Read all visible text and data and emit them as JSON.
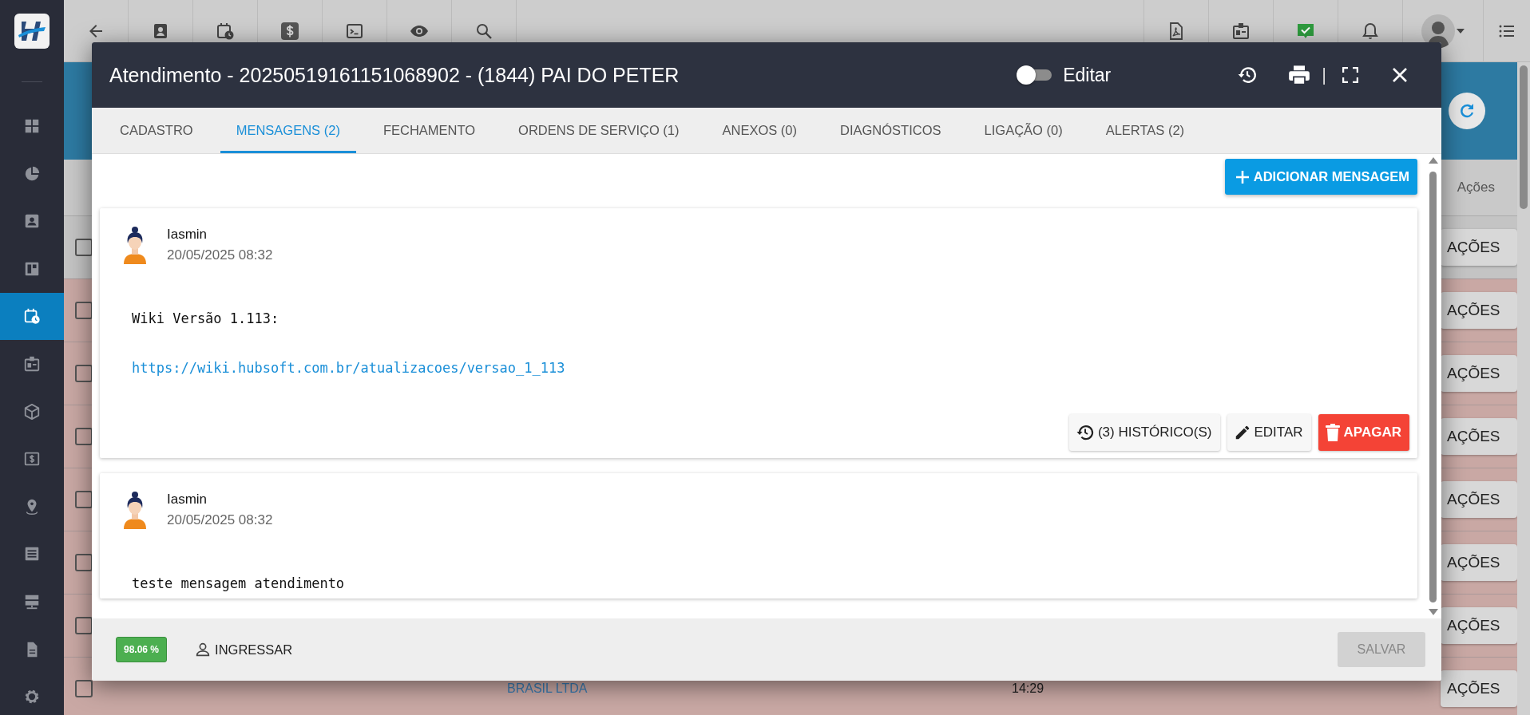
{
  "sidebar": {
    "items": [
      {
        "kind": "dashboard",
        "selected": false
      },
      {
        "kind": "chart",
        "selected": false
      },
      {
        "kind": "contact",
        "selected": false
      },
      {
        "kind": "board",
        "selected": false
      },
      {
        "kind": "calendar",
        "selected": true
      },
      {
        "kind": "badge",
        "selected": false
      },
      {
        "kind": "box",
        "selected": false
      },
      {
        "kind": "money",
        "selected": false
      },
      {
        "kind": "pin",
        "selected": false
      },
      {
        "kind": "list",
        "selected": false
      },
      {
        "kind": "server",
        "selected": false
      },
      {
        "kind": "document",
        "selected": false
      },
      {
        "kind": "settings",
        "selected": false
      }
    ]
  },
  "table": {
    "actions_header": "Ações",
    "rows": [
      {
        "checked": false,
        "color": "#c4c4c4",
        "action": "AÇÕES"
      },
      {
        "checked": false,
        "color": "#c9a8a4",
        "action": "AÇÕES"
      },
      {
        "checked": false,
        "color": "#c9a8a4",
        "action": "AÇÕES"
      },
      {
        "checked": false,
        "color": "#c9a8a4",
        "action": "AÇÕES"
      },
      {
        "checked": false,
        "color": "#c9a8a4",
        "action": "AÇÕES"
      },
      {
        "checked": false,
        "color": "#c9a8a4",
        "action": "AÇÕES"
      },
      {
        "checked": false,
        "color": "#c9a8a4",
        "action": "AÇÕES"
      },
      {
        "checked": false,
        "color": "#c9a8a4",
        "action": "AÇÕES",
        "company": "BRASIL LTDA",
        "time": "14:29"
      }
    ]
  },
  "modal": {
    "title": "Atendimento - 20250519161151068902 - (1844) PAI DO PETER",
    "edit_toggle": {
      "label": "Editar",
      "on": false
    },
    "separator": "|",
    "tabs": [
      {
        "label": "CADASTRO",
        "selected": false
      },
      {
        "label": "MENSAGENS (2)",
        "selected": true
      },
      {
        "label": "FECHAMENTO",
        "selected": false
      },
      {
        "label": "ORDENS DE SERVIÇO (1)",
        "selected": false
      },
      {
        "label": "ANEXOS (0)",
        "selected": false
      },
      {
        "label": "DIAGNÓSTICOS",
        "selected": false
      },
      {
        "label": "LIGAÇÃO (0)",
        "selected": false
      },
      {
        "label": "ALERTAS (2)",
        "selected": false
      }
    ],
    "add_button": "ADICIONAR MENSAGEM",
    "messages": [
      {
        "author": "Iasmin",
        "date": "20/05/2025 08:32",
        "body": [
          {
            "kind": "text",
            "text": "Wiki Versão 1.113:"
          },
          {
            "kind": "link",
            "text": "https://wiki.hubsoft.com.br/atualizacoes/versao_1_113"
          }
        ],
        "actions": [
          {
            "kind": "history",
            "label": "(3) HISTÓRICO(S)"
          },
          {
            "kind": "edit",
            "label": "EDITAR"
          },
          {
            "kind": "delete",
            "label": "APAGAR"
          }
        ]
      },
      {
        "author": "Iasmin",
        "date": "20/05/2025 08:32",
        "body": [
          {
            "kind": "text",
            "text": "teste mensagem atendimento"
          }
        ]
      }
    ],
    "footer": {
      "score": "98.06 %",
      "join_button": "INGRESSAR",
      "save_button": {
        "label": "SALVAR",
        "disabled": true
      }
    }
  }
}
